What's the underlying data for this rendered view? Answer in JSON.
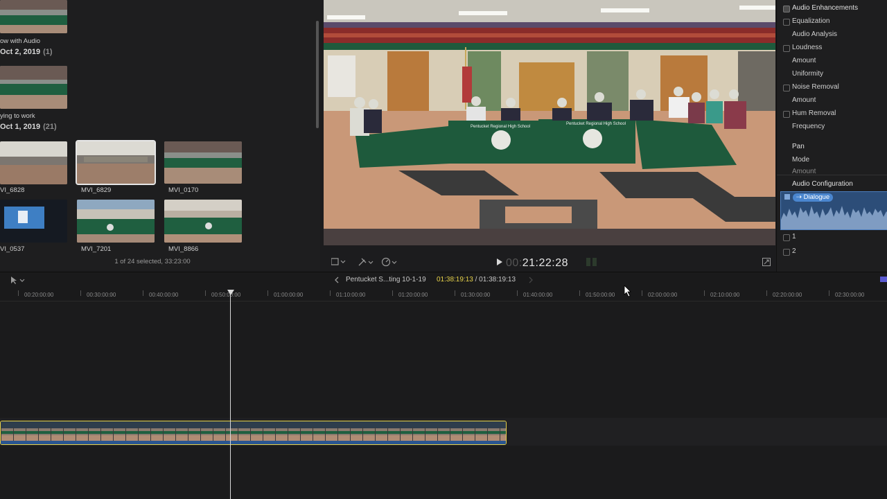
{
  "browser": {
    "groups": [
      {
        "date": "Oct 2, 2019",
        "count": "(1)"
      },
      {
        "date": "Oct 1, 2019",
        "count": "(21)"
      }
    ],
    "group_labels": [
      "ow with Audio",
      "ying to work"
    ],
    "clips": [
      "VI_6828",
      "MVI_6829",
      "MVI_0170",
      "VI_0537",
      "MVI_7201",
      "MVI_8866"
    ],
    "status": "1 of 24 selected, 33:23:00"
  },
  "viewer": {
    "timecode_dim": "00:",
    "timecode": "21:22:28",
    "banner_text": "Pentucket Regional High School"
  },
  "inspector": {
    "items": [
      {
        "label": "Audio Enhancements",
        "kind": "header"
      },
      {
        "label": "Equalization",
        "kind": "check"
      },
      {
        "label": "Audio Analysis",
        "kind": "sub"
      },
      {
        "label": "Loudness",
        "kind": "check"
      },
      {
        "label": "Amount",
        "kind": "sub"
      },
      {
        "label": "Uniformity",
        "kind": "sub"
      },
      {
        "label": "Noise Removal",
        "kind": "check"
      },
      {
        "label": "Amount",
        "kind": "sub"
      },
      {
        "label": "Hum Removal",
        "kind": "check"
      },
      {
        "label": "Frequency",
        "kind": "sub"
      }
    ],
    "pan_header": "Pan",
    "pan_mode": "Mode",
    "pan_amount": "Amount",
    "audio_config_header": "Audio Configuration",
    "role": "Dialogue",
    "channels": [
      "1",
      "2"
    ]
  },
  "timeline": {
    "project_name": "Pentucket S...ting 10-1-19",
    "current_time": "01:38:19:13",
    "duration": "01:38:19:13",
    "ticks": [
      "00:20:00:00",
      "00:30:00:00",
      "00:40:00:00",
      "00:50:00:00",
      "01:00:00:00",
      "01:10:00:00",
      "01:20:00:00",
      "01:30:00:00",
      "01:40:00:00",
      "01:50:00:00",
      "02:00:00:00",
      "02:10:00:00",
      "02:20:00:00",
      "02:30:00:00"
    ]
  },
  "colors": {
    "accent_yellow": "#e7d24a",
    "role_blue": "#3a6ea8",
    "table_green": "#1e5a3c"
  }
}
